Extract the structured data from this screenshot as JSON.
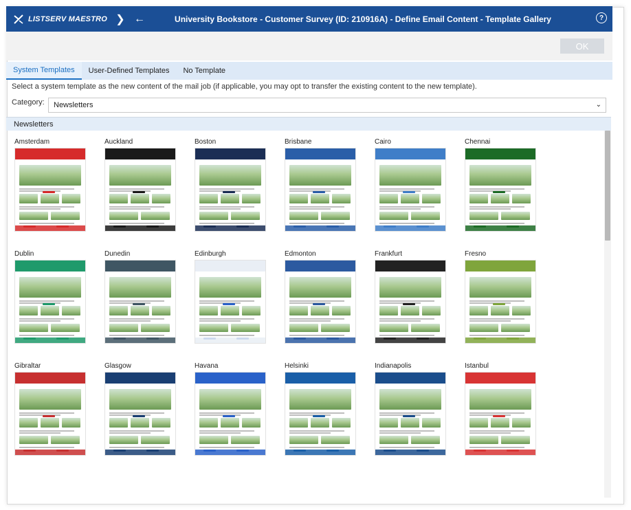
{
  "app": {
    "logo_text": "LISTSERV MAESTRO",
    "title": "University Bookstore - Customer Survey (ID: 210916A) - Define Email Content - Template Gallery"
  },
  "actions": {
    "ok_label": "OK"
  },
  "tabs": [
    {
      "label": "System Templates",
      "active": true
    },
    {
      "label": "User-Defined Templates",
      "active": false
    },
    {
      "label": "No Template",
      "active": false
    }
  ],
  "instructions": "Select a system template as the new content of the mail job (if applicable, you may opt to transfer the existing content to the new template).",
  "category": {
    "label": "Category:",
    "selected": "Newsletters"
  },
  "gallery": {
    "heading": "Newsletters",
    "templates": [
      {
        "name": "Amsterdam",
        "accent": "#d62b2b"
      },
      {
        "name": "Auckland",
        "accent": "#1a1a1a"
      },
      {
        "name": "Boston",
        "accent": "#1b2e55"
      },
      {
        "name": "Brisbane",
        "accent": "#2a5ea8"
      },
      {
        "name": "Cairo",
        "accent": "#3f7ec8"
      },
      {
        "name": "Chennai",
        "accent": "#1c6b26"
      },
      {
        "name": "Dublin",
        "accent": "#1f9a6b"
      },
      {
        "name": "Dunedin",
        "accent": "#3f5663"
      },
      {
        "name": "Edinburgh",
        "accent": "#e9eef5"
      },
      {
        "name": "Edmonton",
        "accent": "#2c5aa0"
      },
      {
        "name": "Frankfurt",
        "accent": "#222222"
      },
      {
        "name": "Fresno",
        "accent": "#7fa53c"
      },
      {
        "name": "Gibraltar",
        "accent": "#c73030"
      },
      {
        "name": "Glasgow",
        "accent": "#1a3f73"
      },
      {
        "name": "Havana",
        "accent": "#2a62c9"
      },
      {
        "name": "Helsinki",
        "accent": "#1a5fa8"
      },
      {
        "name": "Indianapolis",
        "accent": "#1b4e8c"
      },
      {
        "name": "Istanbul",
        "accent": "#d83434"
      }
    ]
  },
  "colors": {
    "topbar": "#1b4f96",
    "active_tab": "#1b6fc2",
    "tab_strip": "#dde9f7"
  }
}
